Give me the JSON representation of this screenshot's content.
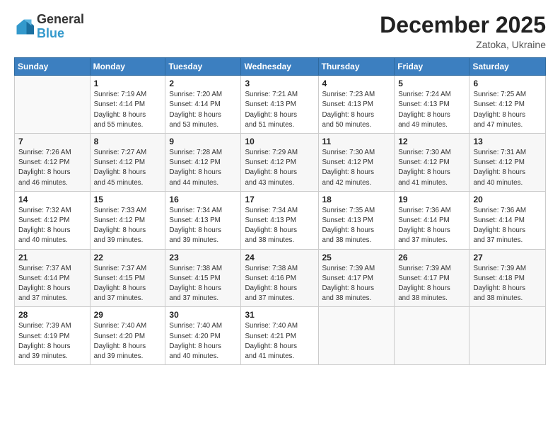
{
  "header": {
    "logo_general": "General",
    "logo_blue": "Blue",
    "month_title": "December 2025",
    "location": "Zatoka, Ukraine"
  },
  "days_of_week": [
    "Sunday",
    "Monday",
    "Tuesday",
    "Wednesday",
    "Thursday",
    "Friday",
    "Saturday"
  ],
  "weeks": [
    [
      {
        "day": "",
        "info": ""
      },
      {
        "day": "1",
        "info": "Sunrise: 7:19 AM\nSunset: 4:14 PM\nDaylight: 8 hours\nand 55 minutes."
      },
      {
        "day": "2",
        "info": "Sunrise: 7:20 AM\nSunset: 4:14 PM\nDaylight: 8 hours\nand 53 minutes."
      },
      {
        "day": "3",
        "info": "Sunrise: 7:21 AM\nSunset: 4:13 PM\nDaylight: 8 hours\nand 51 minutes."
      },
      {
        "day": "4",
        "info": "Sunrise: 7:23 AM\nSunset: 4:13 PM\nDaylight: 8 hours\nand 50 minutes."
      },
      {
        "day": "5",
        "info": "Sunrise: 7:24 AM\nSunset: 4:13 PM\nDaylight: 8 hours\nand 49 minutes."
      },
      {
        "day": "6",
        "info": "Sunrise: 7:25 AM\nSunset: 4:12 PM\nDaylight: 8 hours\nand 47 minutes."
      }
    ],
    [
      {
        "day": "7",
        "info": "Sunrise: 7:26 AM\nSunset: 4:12 PM\nDaylight: 8 hours\nand 46 minutes."
      },
      {
        "day": "8",
        "info": "Sunrise: 7:27 AM\nSunset: 4:12 PM\nDaylight: 8 hours\nand 45 minutes."
      },
      {
        "day": "9",
        "info": "Sunrise: 7:28 AM\nSunset: 4:12 PM\nDaylight: 8 hours\nand 44 minutes."
      },
      {
        "day": "10",
        "info": "Sunrise: 7:29 AM\nSunset: 4:12 PM\nDaylight: 8 hours\nand 43 minutes."
      },
      {
        "day": "11",
        "info": "Sunrise: 7:30 AM\nSunset: 4:12 PM\nDaylight: 8 hours\nand 42 minutes."
      },
      {
        "day": "12",
        "info": "Sunrise: 7:30 AM\nSunset: 4:12 PM\nDaylight: 8 hours\nand 41 minutes."
      },
      {
        "day": "13",
        "info": "Sunrise: 7:31 AM\nSunset: 4:12 PM\nDaylight: 8 hours\nand 40 minutes."
      }
    ],
    [
      {
        "day": "14",
        "info": "Sunrise: 7:32 AM\nSunset: 4:12 PM\nDaylight: 8 hours\nand 40 minutes."
      },
      {
        "day": "15",
        "info": "Sunrise: 7:33 AM\nSunset: 4:12 PM\nDaylight: 8 hours\nand 39 minutes."
      },
      {
        "day": "16",
        "info": "Sunrise: 7:34 AM\nSunset: 4:13 PM\nDaylight: 8 hours\nand 39 minutes."
      },
      {
        "day": "17",
        "info": "Sunrise: 7:34 AM\nSunset: 4:13 PM\nDaylight: 8 hours\nand 38 minutes."
      },
      {
        "day": "18",
        "info": "Sunrise: 7:35 AM\nSunset: 4:13 PM\nDaylight: 8 hours\nand 38 minutes."
      },
      {
        "day": "19",
        "info": "Sunrise: 7:36 AM\nSunset: 4:14 PM\nDaylight: 8 hours\nand 37 minutes."
      },
      {
        "day": "20",
        "info": "Sunrise: 7:36 AM\nSunset: 4:14 PM\nDaylight: 8 hours\nand 37 minutes."
      }
    ],
    [
      {
        "day": "21",
        "info": "Sunrise: 7:37 AM\nSunset: 4:14 PM\nDaylight: 8 hours\nand 37 minutes."
      },
      {
        "day": "22",
        "info": "Sunrise: 7:37 AM\nSunset: 4:15 PM\nDaylight: 8 hours\nand 37 minutes."
      },
      {
        "day": "23",
        "info": "Sunrise: 7:38 AM\nSunset: 4:15 PM\nDaylight: 8 hours\nand 37 minutes."
      },
      {
        "day": "24",
        "info": "Sunrise: 7:38 AM\nSunset: 4:16 PM\nDaylight: 8 hours\nand 37 minutes."
      },
      {
        "day": "25",
        "info": "Sunrise: 7:39 AM\nSunset: 4:17 PM\nDaylight: 8 hours\nand 38 minutes."
      },
      {
        "day": "26",
        "info": "Sunrise: 7:39 AM\nSunset: 4:17 PM\nDaylight: 8 hours\nand 38 minutes."
      },
      {
        "day": "27",
        "info": "Sunrise: 7:39 AM\nSunset: 4:18 PM\nDaylight: 8 hours\nand 38 minutes."
      }
    ],
    [
      {
        "day": "28",
        "info": "Sunrise: 7:39 AM\nSunset: 4:19 PM\nDaylight: 8 hours\nand 39 minutes."
      },
      {
        "day": "29",
        "info": "Sunrise: 7:40 AM\nSunset: 4:20 PM\nDaylight: 8 hours\nand 39 minutes."
      },
      {
        "day": "30",
        "info": "Sunrise: 7:40 AM\nSunset: 4:20 PM\nDaylight: 8 hours\nand 40 minutes."
      },
      {
        "day": "31",
        "info": "Sunrise: 7:40 AM\nSunset: 4:21 PM\nDaylight: 8 hours\nand 41 minutes."
      },
      {
        "day": "",
        "info": ""
      },
      {
        "day": "",
        "info": ""
      },
      {
        "day": "",
        "info": ""
      }
    ]
  ]
}
